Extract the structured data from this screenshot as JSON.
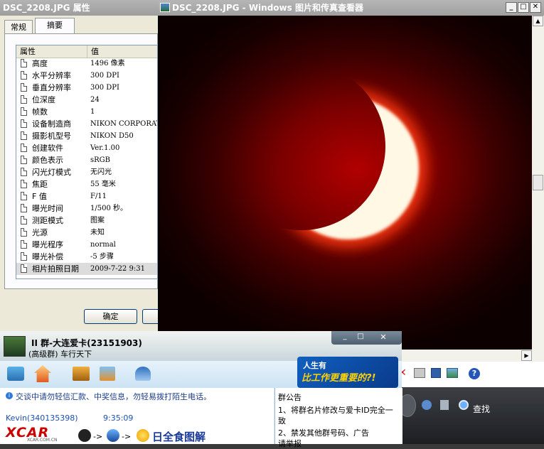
{
  "properties_dialog": {
    "title": "DSC_2208.JPG 属性",
    "tabs": [
      "常规",
      "摘要"
    ],
    "columns": {
      "property": "属性",
      "value": "值"
    },
    "rows": [
      {
        "name": "高度",
        "value": "1496 像素"
      },
      {
        "name": "水平分辨率",
        "value": "300 DPI"
      },
      {
        "name": "垂直分辨率",
        "value": "300 DPI"
      },
      {
        "name": "位深度",
        "value": "24"
      },
      {
        "name": "帧数",
        "value": "1"
      },
      {
        "name": "设备制造商",
        "value": "NIKON CORPORATIO"
      },
      {
        "name": "摄影机型号",
        "value": "NIKON D50"
      },
      {
        "name": "创建软件",
        "value": "Ver.1.00"
      },
      {
        "name": "颜色表示",
        "value": "sRGB"
      },
      {
        "name": "闪光灯模式",
        "value": "无闪光"
      },
      {
        "name": "焦距",
        "value": "55 毫米"
      },
      {
        "name": "F 值",
        "value": "F/11"
      },
      {
        "name": "曝光时间",
        "value": "1/500 秒。"
      },
      {
        "name": "测距模式",
        "value": "图案"
      },
      {
        "name": "光源",
        "value": "未知"
      },
      {
        "name": "曝光程序",
        "value": "normal"
      },
      {
        "name": "曝光补偿",
        "value": "-5 步骤"
      },
      {
        "name": "相片拍照日期",
        "value": "2009-7-22 9:31"
      }
    ],
    "ok_label": "确定"
  },
  "viewer": {
    "title": "DSC_2208.JPG - Windows 图片和传真查看器",
    "controls": {
      "minimize": "_",
      "maximize": "□",
      "close": "✕"
    }
  },
  "qq": {
    "group_name": "II 群-大连爱卡(23151903)",
    "group_sub": "(高级群) 车行天下",
    "ad_line1": "人生有",
    "ad_line2": "比工作更重要的?!",
    "warning": "交谈中请勿轻信汇款、中奖信息，勿轻易拨打陌生电话。",
    "sender": "Kevin(340135398)",
    "time": "9:35:09",
    "message": "日全食图解",
    "arrow": "->",
    "notice_title": "群公告",
    "notice_lines": [
      "1、将群名片修改与爱卡ID完全一致",
      "2、禁发其他群号码、广告",
      "请举报"
    ],
    "logo": "XCAR",
    "logo_site": "XCAR.COM.CN"
  },
  "taskbar": {
    "search_label": "查找"
  },
  "colors": {
    "sun_glow": "#b10000",
    "crescent": "#fff8e4",
    "qq_bg": "#d6e9f7"
  }
}
